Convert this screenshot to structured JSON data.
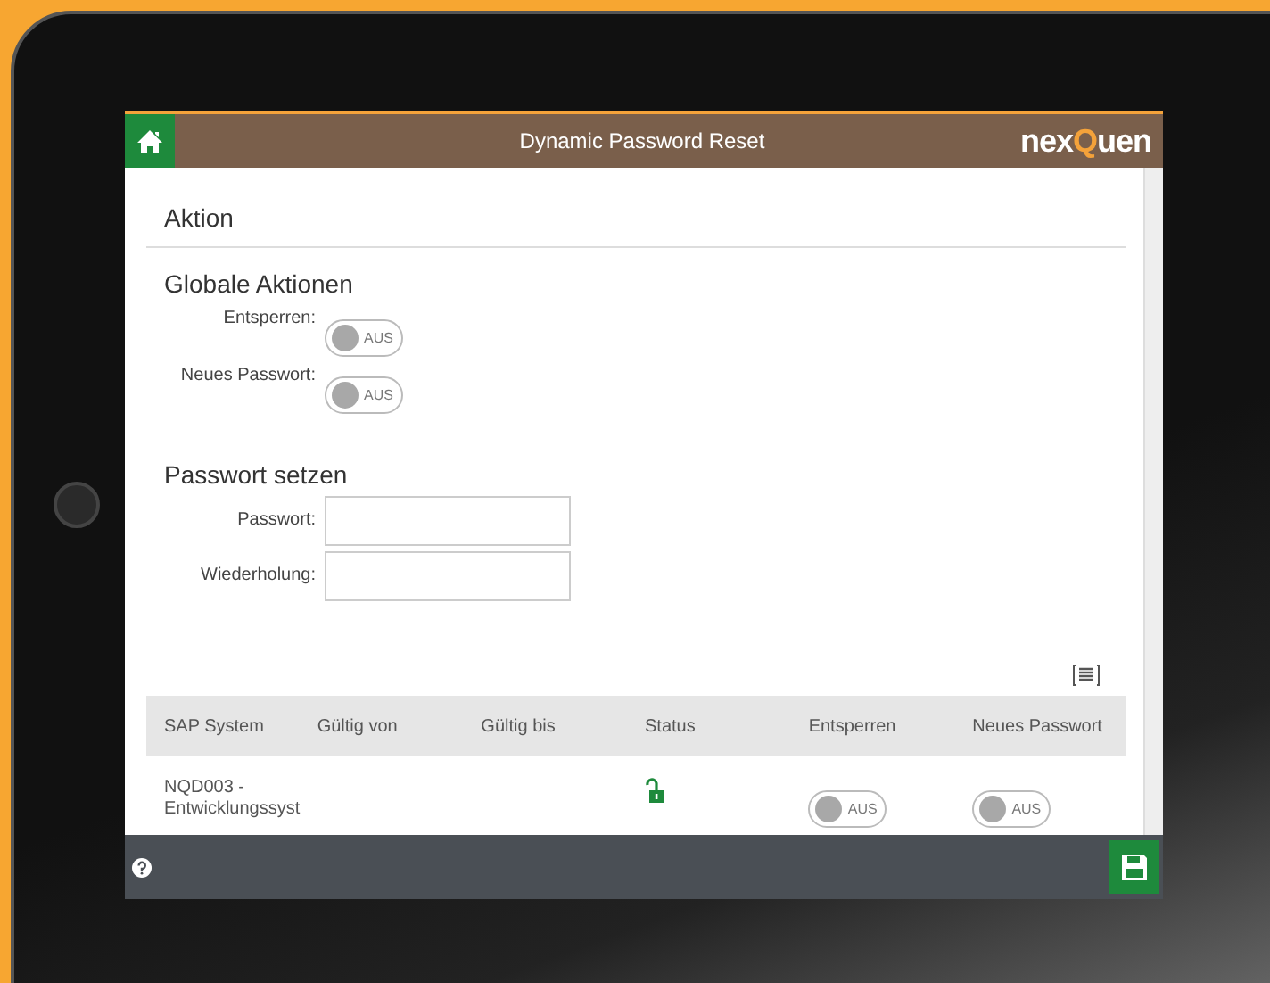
{
  "header": {
    "title": "Dynamic Password Reset",
    "logo": {
      "prefix": "nex",
      "highlight": "Q",
      "suffix": "uen"
    }
  },
  "section_title": "Aktion",
  "global_actions": {
    "title": "Globale Aktionen",
    "toggles": [
      {
        "label": "Entsperren:",
        "on": false,
        "text": "AUS"
      },
      {
        "label": "Neues Passwort:",
        "on": false,
        "text": "AUS"
      }
    ]
  },
  "password": {
    "title": "Passwort setzen",
    "fields": [
      {
        "label": "Passwort:"
      },
      {
        "label": "Wiederholung:"
      }
    ]
  },
  "table": {
    "columns": [
      "SAP System",
      "Gültig von",
      "Gültig bis",
      "Status",
      "Entsperren",
      "Neues Passwort"
    ],
    "rows": [
      {
        "system": "NQD003 - Entwicklungssyst",
        "locked": false,
        "unlock": {
          "on": false,
          "text": "AUS"
        },
        "new_password": {
          "on": false,
          "text": "AUS"
        }
      }
    ]
  }
}
